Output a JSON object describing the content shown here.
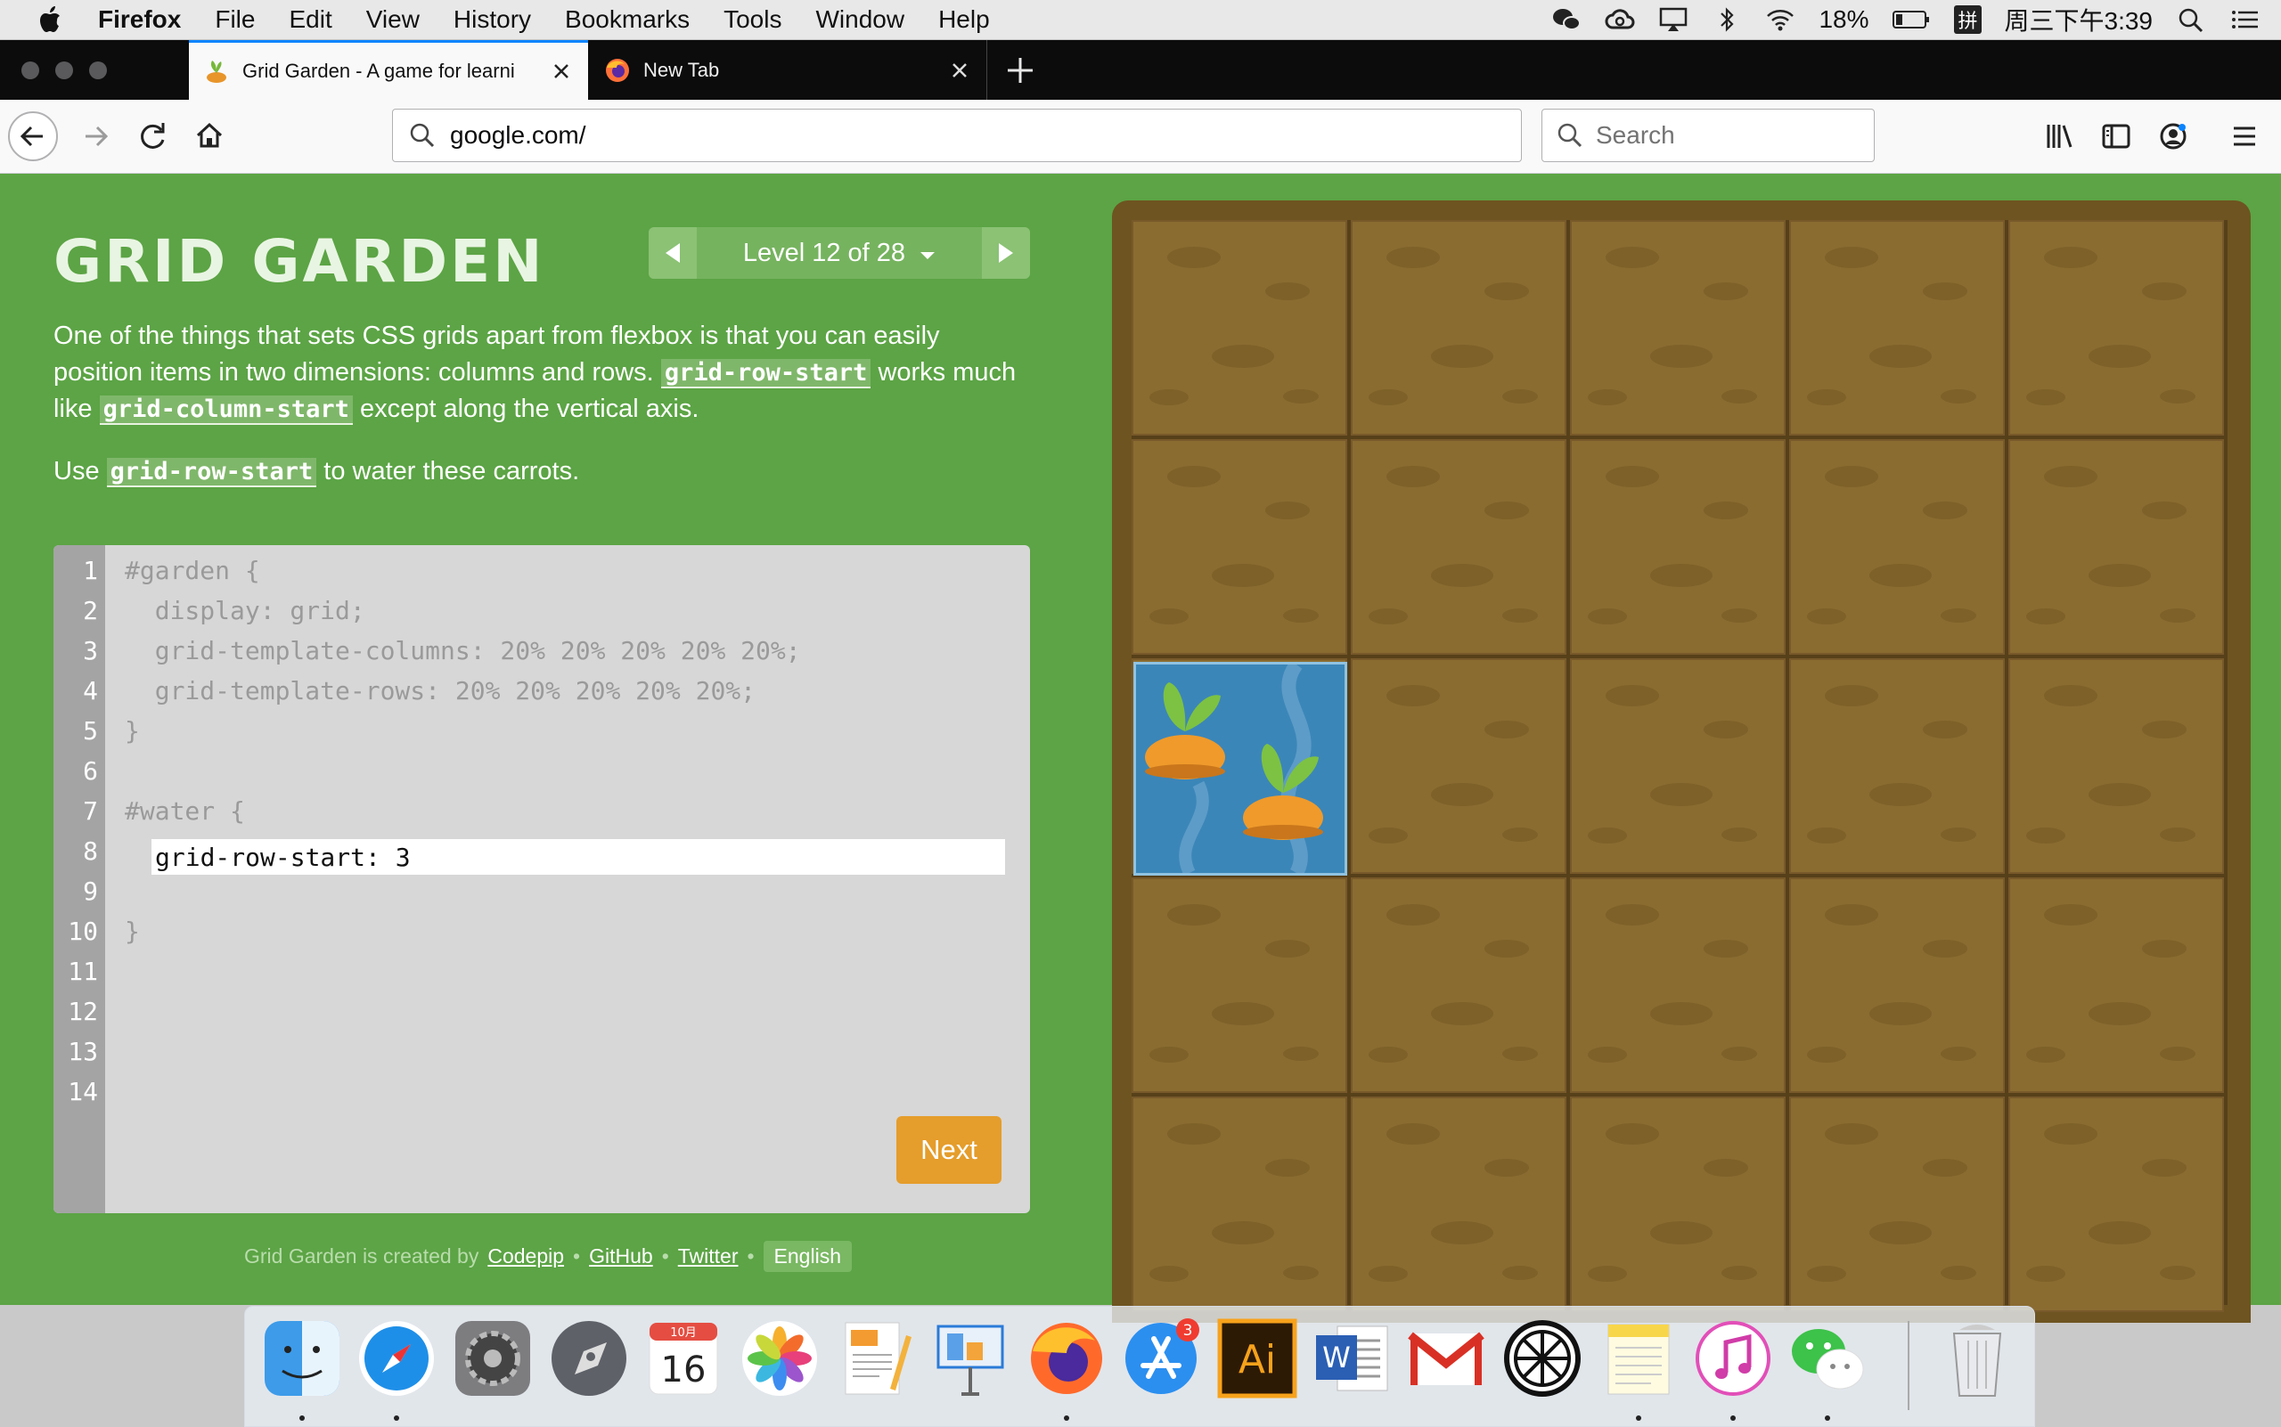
{
  "menubar": {
    "app": "Firefox",
    "items": [
      "File",
      "Edit",
      "View",
      "History",
      "Bookmarks",
      "Tools",
      "Window",
      "Help"
    ],
    "battery": "18%",
    "input_method": "拼",
    "clock": "周三下午3:39"
  },
  "browser": {
    "tabs": [
      {
        "title": "Grid Garden - A game for learni",
        "active": true
      },
      {
        "title": "New Tab",
        "active": false
      }
    ],
    "url": "google.com/",
    "search_placeholder": "Search"
  },
  "game": {
    "title": "GRID GARDEN",
    "level_label": "Level 12 of 28",
    "level_current": 12,
    "level_total": 28,
    "description": {
      "p1_a": "One of the things that sets CSS grids apart from flexbox is that you can easily position items in two dimensions: columns and rows. ",
      "p1_code1": "grid-row-start",
      "p1_b": " works much like ",
      "p1_code2": "grid-column-start",
      "p1_c": " except along the vertical axis.",
      "p2_a": "Use ",
      "p2_code": "grid-row-start",
      "p2_b": " to water these carrots."
    },
    "editor": {
      "line_numbers": [
        "1",
        "2",
        "3",
        "4",
        "5",
        "6",
        "7",
        "8",
        "9",
        "10",
        "11",
        "12",
        "13",
        "14"
      ],
      "lines": {
        "l1": "#garden {",
        "l2": "  display: grid;",
        "l3": "  grid-template-columns: 20% 20% 20% 20% 20%;",
        "l4": "  grid-template-rows: 20% 20% 20% 20% 20%;",
        "l5": "}",
        "l7": "#water {",
        "l10": "}"
      },
      "input_value": "grid-row-start: 3"
    },
    "next_label": "Next",
    "footer": {
      "prefix": "Grid Garden is created by",
      "codepip": "Codepip",
      "sep": "•",
      "github": "GitHub",
      "twitter": "Twitter",
      "language": "English"
    },
    "garden": {
      "rows": 5,
      "columns": 5,
      "water_row": 3,
      "water_column": 1,
      "carrots": 2
    }
  },
  "dock": {
    "apps": [
      "finder",
      "safari",
      "system-preferences",
      "launchpad",
      "calendar",
      "photos",
      "pages",
      "keynote",
      "firefox",
      "app-store",
      "illustrator",
      "word",
      "gmail",
      "lemon",
      "notes",
      "itunes",
      "wechat",
      "trash"
    ],
    "calendar_month": "10月",
    "calendar_day": "16",
    "app_store_badge": "3",
    "illustrator_label": "Ai",
    "word_label": "W"
  },
  "colors": {
    "page_bg": "#5ca445",
    "soil": "#8a6c31",
    "water": "#3b86b8",
    "next_button": "#e59d2b",
    "tab_accent": "#0a84ff"
  }
}
